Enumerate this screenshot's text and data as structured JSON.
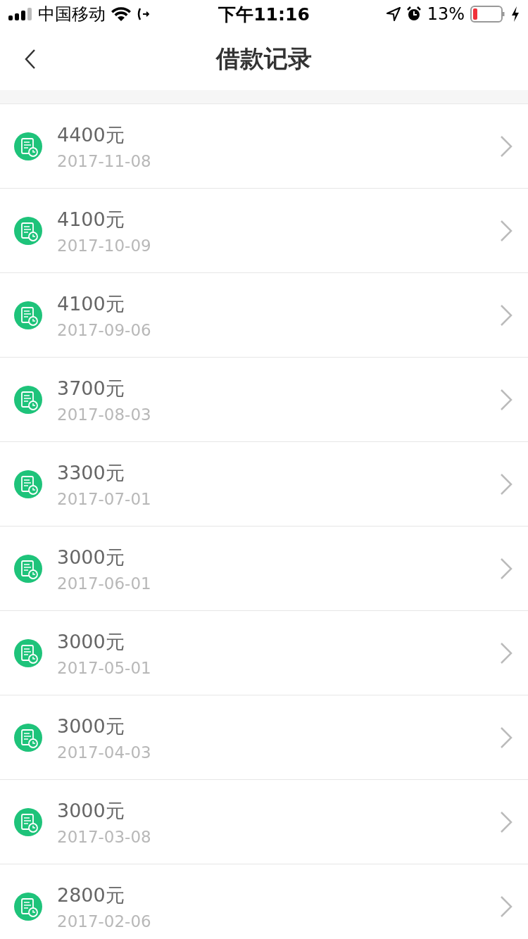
{
  "status_bar": {
    "carrier": "中国移动",
    "time": "下午11:16",
    "battery": "13%"
  },
  "nav": {
    "title": "借款记录"
  },
  "records": [
    {
      "amount": "4400元",
      "date": "2017-11-08"
    },
    {
      "amount": "4100元",
      "date": "2017-10-09"
    },
    {
      "amount": "4100元",
      "date": "2017-09-06"
    },
    {
      "amount": "3700元",
      "date": "2017-08-03"
    },
    {
      "amount": "3300元",
      "date": "2017-07-01"
    },
    {
      "amount": "3000元",
      "date": "2017-06-01"
    },
    {
      "amount": "3000元",
      "date": "2017-05-01"
    },
    {
      "amount": "3000元",
      "date": "2017-04-03"
    },
    {
      "amount": "3000元",
      "date": "2017-03-08"
    },
    {
      "amount": "2800元",
      "date": "2017-02-06"
    }
  ]
}
